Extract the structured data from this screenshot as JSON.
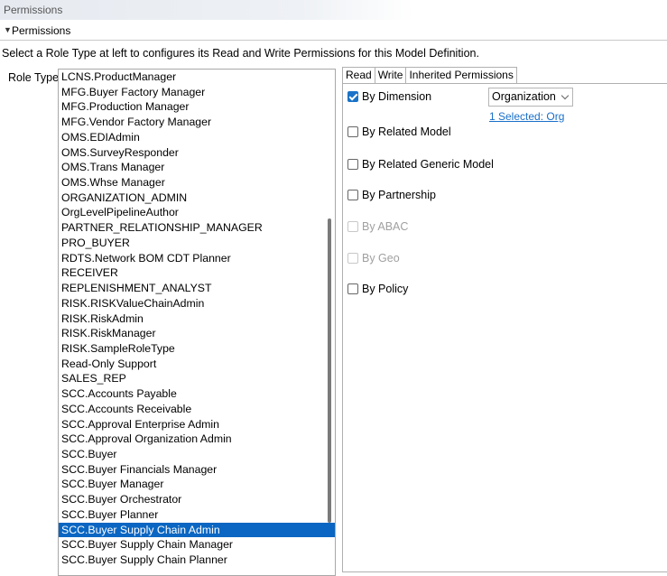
{
  "window": {
    "title": "Permissions"
  },
  "section": {
    "title": "Permissions"
  },
  "instructions": "Select a Role Type at left to configures its Read and Write Permissions for this Model Definition.",
  "role_type_label": "Role Type:",
  "roles": [
    "LCNS.ProductManager",
    "MFG.Buyer Factory Manager",
    "MFG.Production Manager",
    "MFG.Vendor Factory Manager",
    "OMS.EDIAdmin",
    "OMS.SurveyResponder",
    "OMS.Trans Manager",
    "OMS.Whse Manager",
    "ORGANIZATION_ADMIN",
    "OrgLevelPipelineAuthor",
    "PARTNER_RELATIONSHIP_MANAGER",
    "PRO_BUYER",
    "RDTS.Network BOM CDT Planner",
    "RECEIVER",
    "REPLENISHMENT_ANALYST",
    "RISK.RISKValueChainAdmin",
    "RISK.RiskAdmin",
    "RISK.RiskManager",
    "RISK.SampleRoleType",
    "Read-Only Support",
    "SALES_REP",
    "SCC.Accounts Payable",
    "SCC.Accounts Receivable",
    "SCC.Approval Enterprise Admin",
    "SCC.Approval Organization Admin",
    "SCC.Buyer",
    "SCC.Buyer Financials Manager",
    "SCC.Buyer Manager",
    "SCC.Buyer Orchestrator",
    "SCC.Buyer Planner",
    "SCC.Buyer Supply Chain Admin",
    "SCC.Buyer Supply Chain Manager",
    "SCC.Buyer Supply Chain Planner"
  ],
  "selected_role": "SCC.Buyer Supply Chain Admin",
  "tabs": [
    "Read",
    "Write",
    "Inherited Permissions"
  ],
  "active_tab": "Read",
  "options": [
    {
      "label": "By Dimension",
      "checked": true,
      "disabled": false
    },
    {
      "label": "By Related Model",
      "checked": false,
      "disabled": false
    },
    {
      "label": "By Related Generic Model",
      "checked": false,
      "disabled": false
    },
    {
      "label": "By Partnership",
      "checked": false,
      "disabled": false
    },
    {
      "label": "By ABAC",
      "checked": false,
      "disabled": true
    },
    {
      "label": "By Geo",
      "checked": false,
      "disabled": true
    },
    {
      "label": "By Policy",
      "checked": false,
      "disabled": false
    }
  ],
  "dimension_select": {
    "value": "Organization"
  },
  "dimension_link": "1 Selected: Org",
  "colors": {
    "accent": "#0a66c2",
    "link": "#1a6fc9"
  }
}
